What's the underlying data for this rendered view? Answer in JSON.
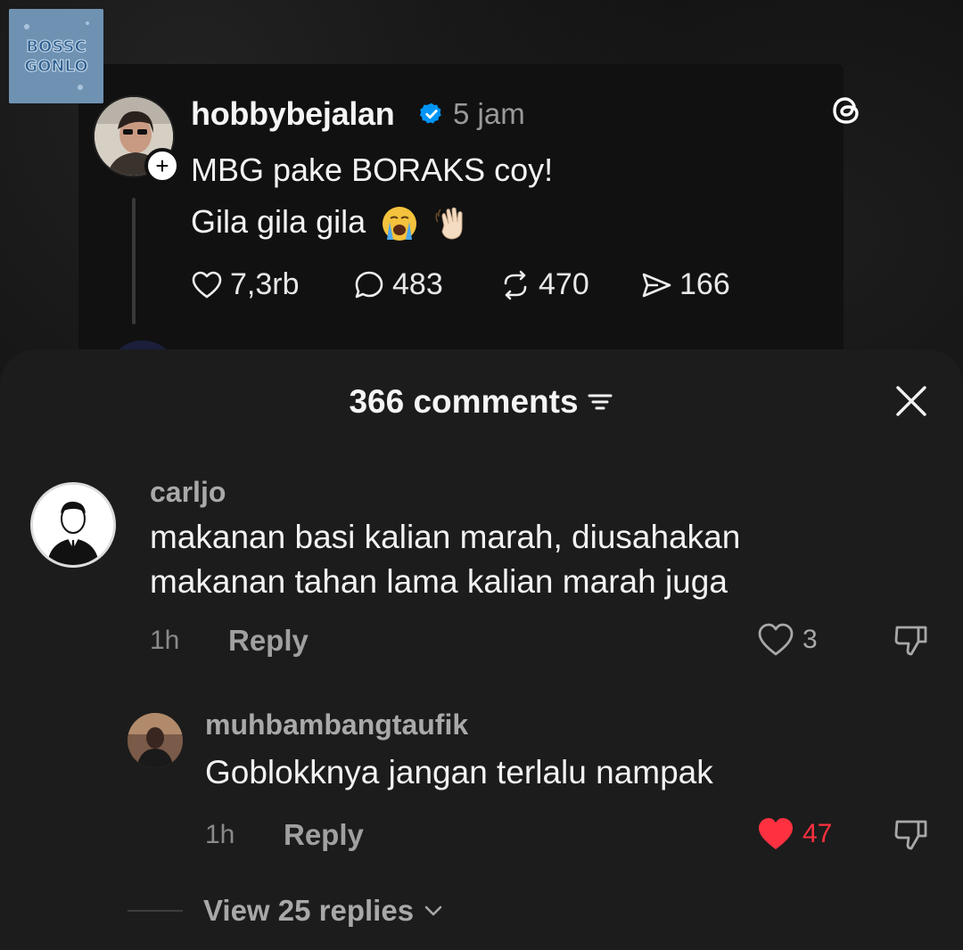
{
  "post": {
    "username": "hobbybejalan",
    "time": "5 jam",
    "line1": "MBG pake BORAKS coy!",
    "line2": "Gila gila gila",
    "emojis": [
      "crying-face-emoji",
      "waving-hand-emoji"
    ],
    "stats": {
      "likes": "7,3rb",
      "comments": "483",
      "reposts": "470",
      "shares": "166"
    }
  },
  "sheet": {
    "title": "366 comments"
  },
  "comments": [
    {
      "username": "carljo",
      "text_line1": "makanan basi kalian marah, diusahakan",
      "text_line2": "makanan tahan lama kalian marah juga",
      "time": "1h",
      "reply_label": "Reply",
      "likes": "3",
      "liked": false
    },
    {
      "username": "muhbambangtaufik",
      "text_line1": "Goblokknya jangan terlalu nampak",
      "time": "1h",
      "reply_label": "Reply",
      "likes": "47",
      "liked": true
    }
  ],
  "view_replies": "View 25 replies",
  "colors": {
    "sheet_bg": "#1c1c1c",
    "liked_heart": "#ff3040",
    "verified": "#0095f6",
    "muted_text": "#a8a8a8"
  }
}
